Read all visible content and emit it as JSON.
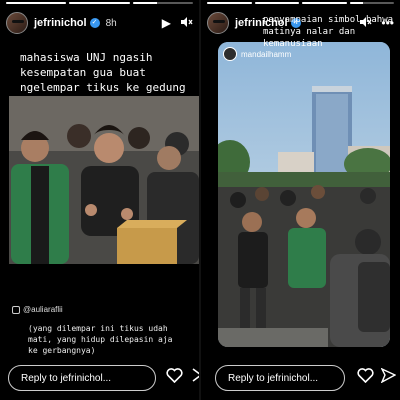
{
  "left_story": {
    "progress": [
      1.0,
      1.0,
      0.4
    ],
    "username": "jefrinichol",
    "verified_icon": "verified-badge-icon",
    "time": "8h",
    "caption": "mahasiswa UNJ ngasih kesempatan gua buat ngelempar tikus ke gedung sarang tikus @dpr_ri",
    "photo_credit": "@auliaraflii",
    "note": "(yang dilempar ini tikus udah mati, yang hidup dilepasin aja ke gerbangnya)",
    "reply_placeholder": "Reply to jefrinichol..."
  },
  "right_story": {
    "progress": [
      1.0,
      1.0,
      1.0,
      0.3
    ],
    "username": "jefrinichol",
    "overlay_text": "penyampaian simbol bahwa matinya nalar dan kemanusiaan",
    "card_username": "mandailhamm",
    "card_subtitle": "",
    "reply_placeholder": "Reply to jefrinichol..."
  },
  "icons": {
    "play": "play-icon",
    "mute": "volume-off-icon",
    "more": "more-horizontal-icon",
    "heart": "heart-icon",
    "send": "send-icon"
  },
  "colors": {
    "background": "#000000",
    "verified": "#3897f0",
    "jacket_green": "#2f7d4a",
    "sky": "#9fc3e0"
  }
}
